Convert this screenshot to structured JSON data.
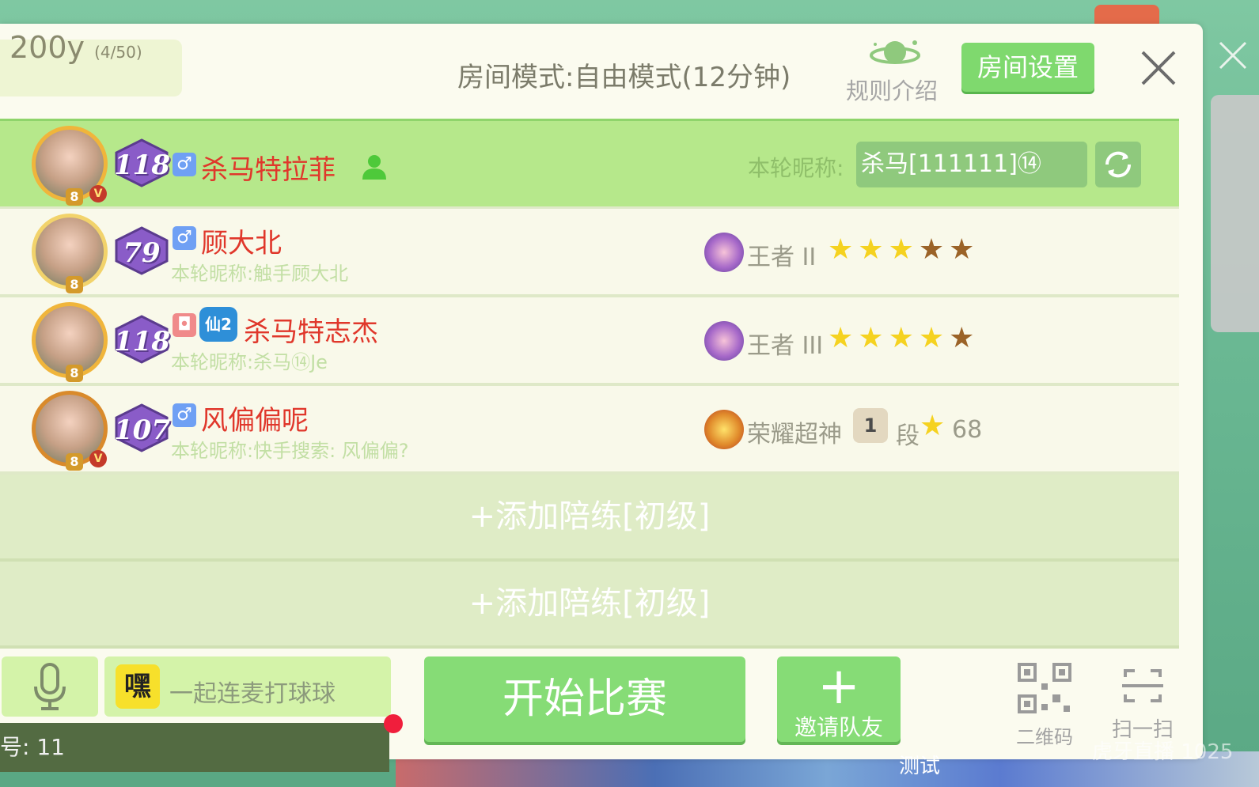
{
  "room": {
    "name": "200y",
    "count": "(4/50)",
    "mode": "房间模式:自由模式(12分钟)"
  },
  "header": {
    "rules_label": "规则介绍",
    "settings_label": "房间设置"
  },
  "players": [
    {
      "level": "118",
      "gender": "♂",
      "name": "杀马特拉菲",
      "round_nick_label": "本轮昵称:",
      "round_nick": "杀马[111111]⑭",
      "avatar_badge": "8",
      "vip": "V"
    },
    {
      "level": "79",
      "gender": "♂",
      "name": "顾大北",
      "sub_nick": "本轮昵称:触手顾大北",
      "rank": "王者 II",
      "stars_on": 3,
      "stars_total": 5,
      "avatar_badge": "8"
    },
    {
      "level": "118",
      "gender": "◘",
      "extra_badge": "仙2",
      "name": "杀马特志杰",
      "sub_nick": "本轮昵称:杀马⑭Je",
      "rank": "王者 III",
      "stars_on": 4,
      "stars_total": 5,
      "avatar_badge": "8"
    },
    {
      "level": "107",
      "gender": "♂",
      "name": "风偏偏呢",
      "sub_nick": "本轮昵称:快手搜索: 风偏偏?",
      "rank": "荣耀超神",
      "tier": "1",
      "tier_suffix": "段",
      "tier_value": "68",
      "avatar_badge": "8",
      "vip": "V"
    }
  ],
  "add_slots": [
    "+添加陪练[初级]",
    "+添加陪练[初级]"
  ],
  "bottom": {
    "chat_icon_text": "嘿",
    "chat_text": "一起连麦打球球",
    "start_label": "开始比赛",
    "invite_label": "邀请队友",
    "qr_label": "二维码",
    "scan_label": "扫一扫",
    "status_text": "号: 11"
  },
  "overlay": {
    "watermark": "虎牙直播 1025",
    "test_tag": "测试"
  },
  "colors": {
    "accent_green": "#86dc76",
    "highlight_row": "#b6e88b",
    "name_red": "#e0372b",
    "star_on": "#f5d220",
    "star_off": "#9b6328"
  }
}
